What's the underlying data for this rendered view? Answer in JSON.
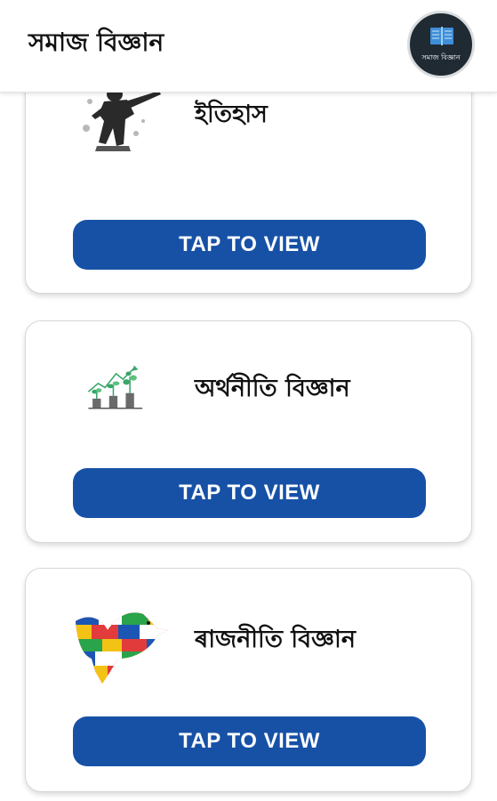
{
  "header": {
    "title": "সমাজ বিজ্ঞান",
    "logo_caption": "সমাজ বিজ্ঞান",
    "logo_icon": "book-icon"
  },
  "cards": [
    {
      "title": "ইতিহাস",
      "icon": "soldier-statue-icon",
      "button_label": "TAP TO VIEW"
    },
    {
      "title": "অৰ্থনীতি বিজ্ঞান",
      "icon": "growth-plants-icon",
      "button_label": "TAP TO VIEW"
    },
    {
      "title": "ৰাজনীতি বিজ্ঞান",
      "icon": "flags-dove-icon",
      "button_label": "TAP TO VIEW"
    }
  ],
  "colors": {
    "button": "#1651a6",
    "logo_background": "#1f2a33"
  }
}
